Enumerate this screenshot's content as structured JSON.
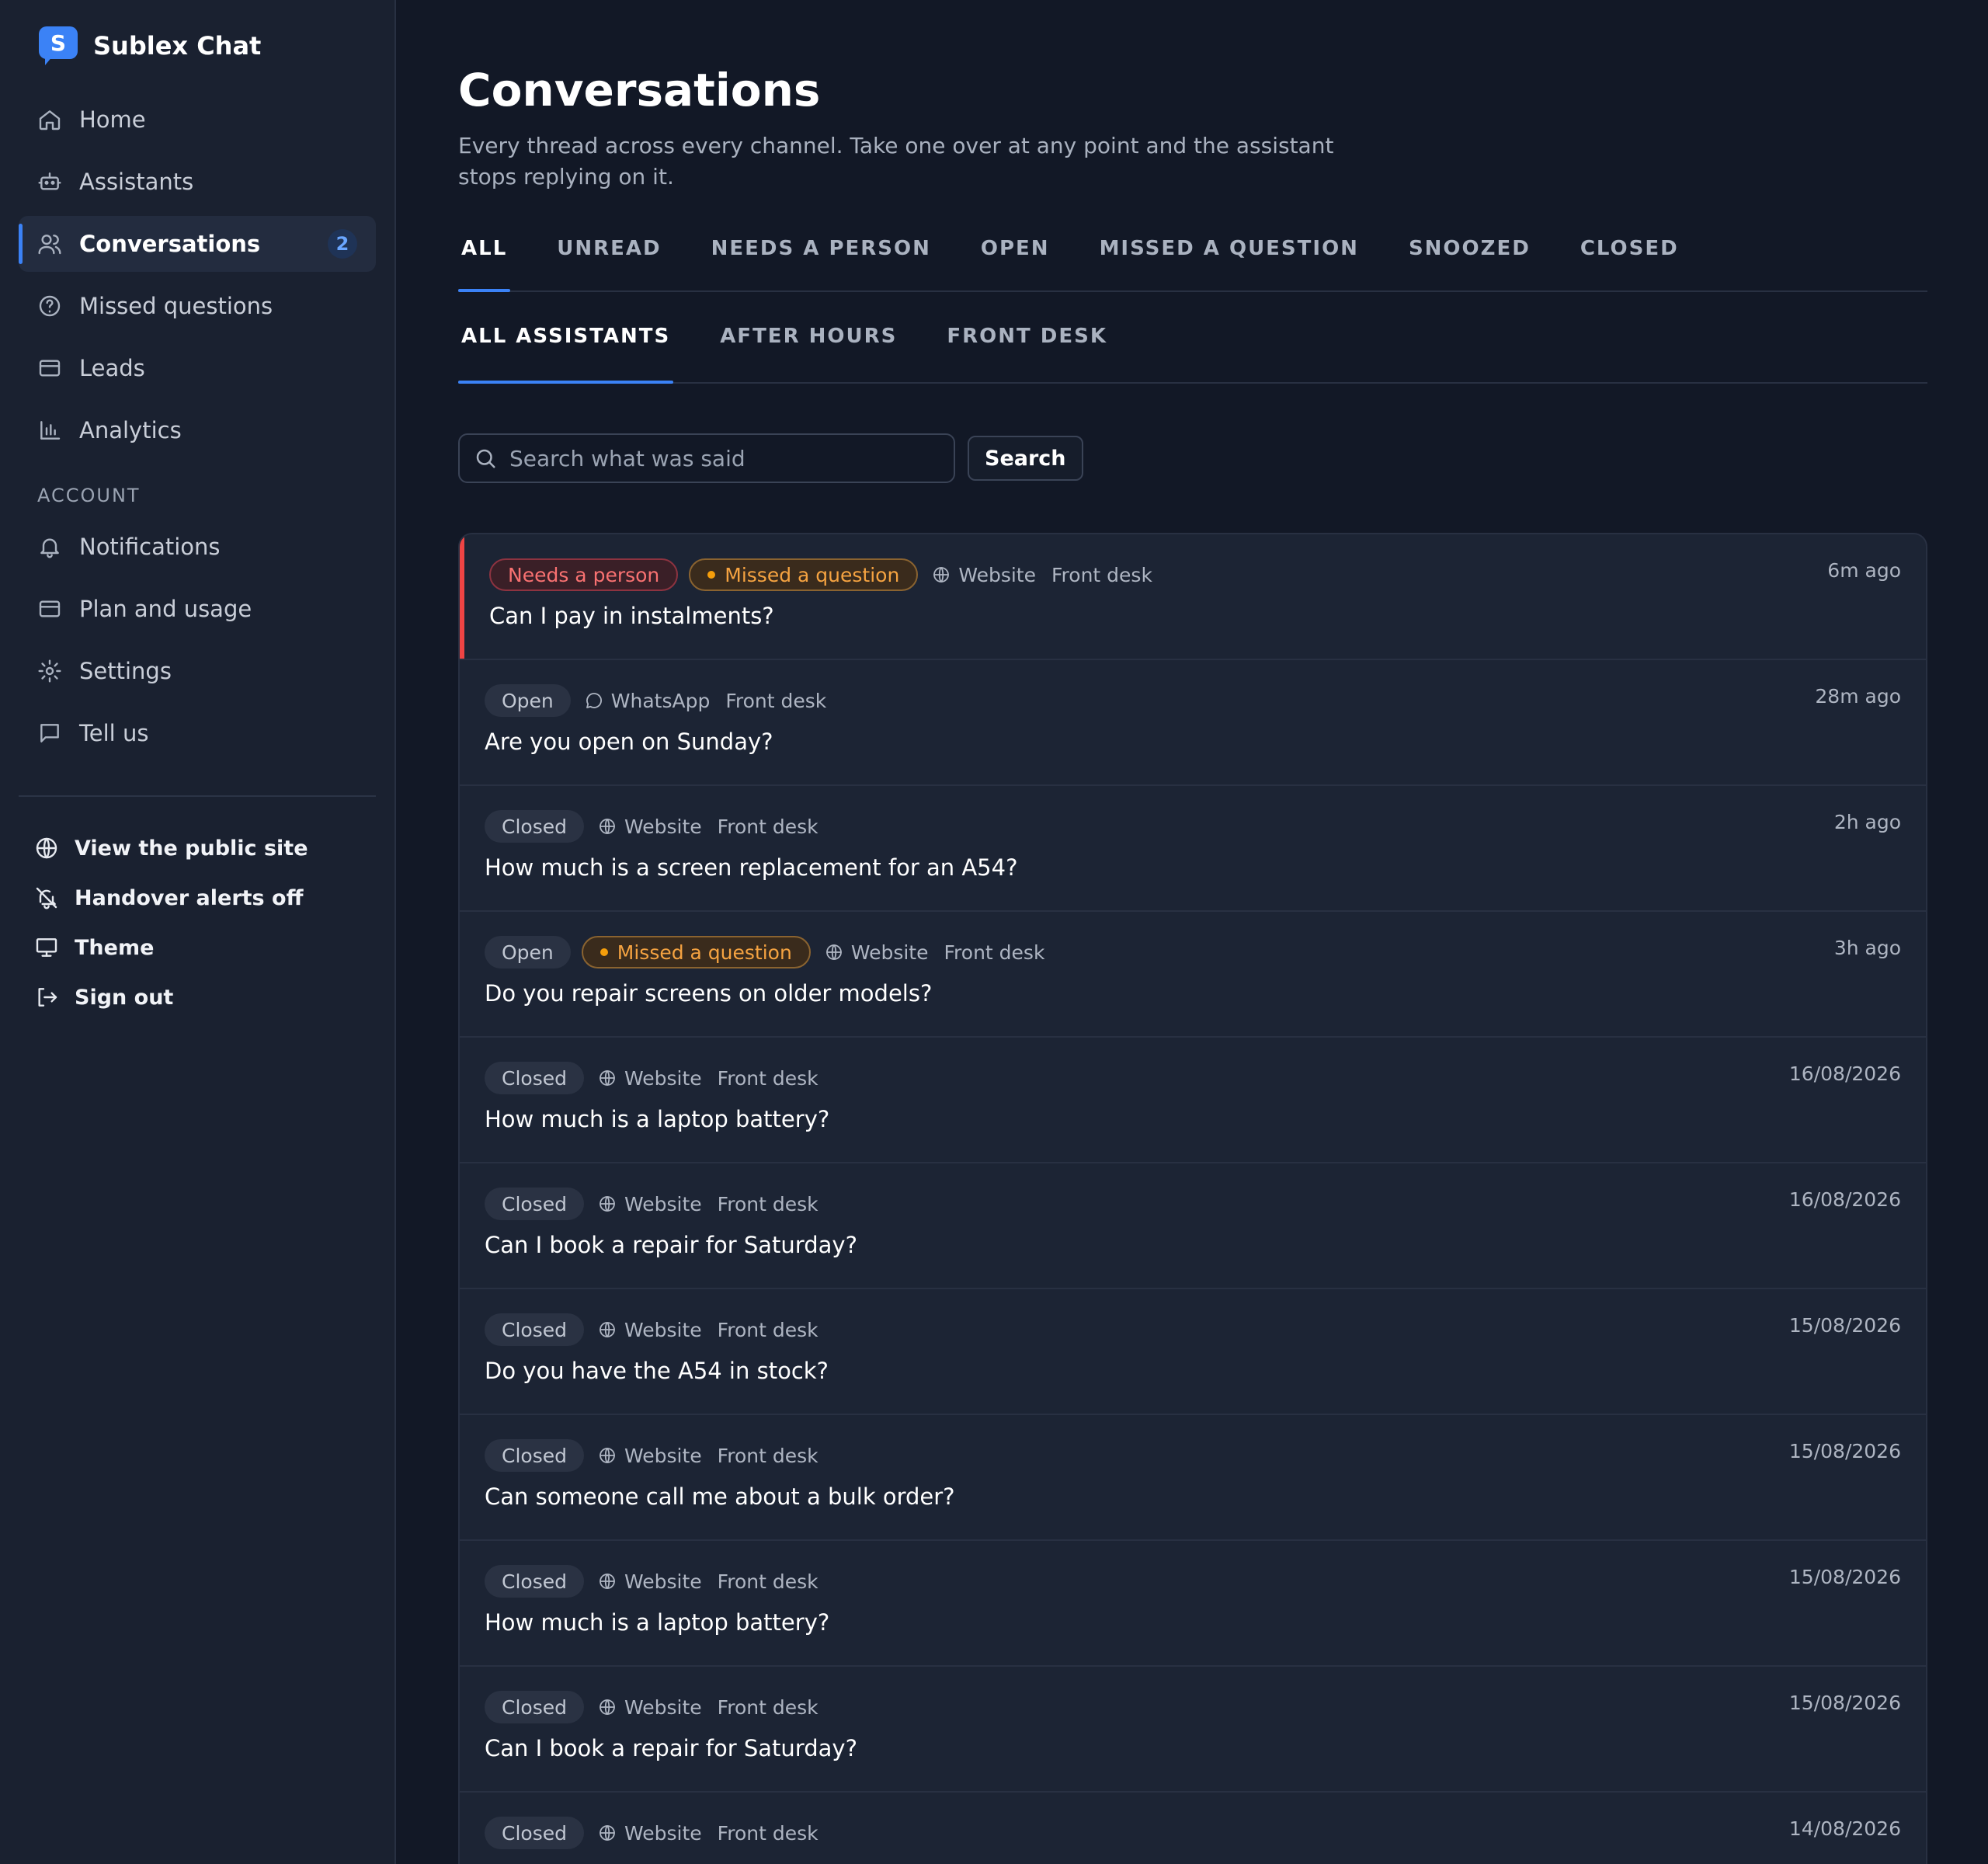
{
  "brand": {
    "logo_letter": "S",
    "name": "Sublex Chat",
    "accent": "#3b82f6"
  },
  "nav": {
    "items": [
      {
        "label": "Home",
        "icon": "home-icon"
      },
      {
        "label": "Assistants",
        "icon": "robot-icon"
      },
      {
        "label": "Conversations",
        "icon": "users-icon",
        "badge": "2",
        "active": true
      },
      {
        "label": "Missed questions",
        "icon": "help-circle-icon"
      },
      {
        "label": "Leads",
        "icon": "card-icon"
      },
      {
        "label": "Analytics",
        "icon": "bar-chart-icon"
      }
    ],
    "account_label": "ACCOUNT",
    "account_items": [
      {
        "label": "Notifications",
        "icon": "bell-icon"
      },
      {
        "label": "Plan and usage",
        "icon": "card-icon"
      },
      {
        "label": "Settings",
        "icon": "gear-icon"
      },
      {
        "label": "Tell us",
        "icon": "message-square-icon"
      }
    ],
    "footer_items": [
      {
        "label": "View the public site",
        "icon": "globe-icon"
      },
      {
        "label": "Handover alerts off",
        "icon": "bell-off-icon"
      },
      {
        "label": "Theme",
        "icon": "monitor-icon"
      },
      {
        "label": "Sign out",
        "icon": "sign-out-icon"
      }
    ]
  },
  "page": {
    "title": "Conversations",
    "subtitle": "Every thread across every channel. Take one over at any point and the assistant stops replying on it."
  },
  "tabs": [
    "ALL",
    "UNREAD",
    "NEEDS A PERSON",
    "OPEN",
    "MISSED A QUESTION",
    "SNOOZED",
    "CLOSED"
  ],
  "active_tab": "ALL",
  "subtabs": [
    "ALL ASSISTANTS",
    "AFTER HOURS",
    "FRONT DESK"
  ],
  "active_subtab": "ALL ASSISTANTS",
  "search": {
    "placeholder": "Search what was said",
    "value": "",
    "button_label": "Search"
  },
  "conversations": [
    {
      "tags": [
        {
          "text": "Needs a person",
          "kind": "danger"
        },
        {
          "text": "Missed a question",
          "kind": "warn"
        }
      ],
      "channel": "Website",
      "assistant": "Front desk",
      "time": "6m ago",
      "question": "Can I pay in instalments?",
      "flagged": true
    },
    {
      "tags": [
        {
          "text": "Open",
          "kind": "neutral"
        }
      ],
      "channel": "WhatsApp",
      "assistant": "Front desk",
      "time": "28m ago",
      "question": "Are you open on Sunday?"
    },
    {
      "tags": [
        {
          "text": "Closed",
          "kind": "neutral"
        }
      ],
      "channel": "Website",
      "assistant": "Front desk",
      "time": "2h ago",
      "question": "How much is a screen replacement for an A54?"
    },
    {
      "tags": [
        {
          "text": "Open",
          "kind": "neutral"
        },
        {
          "text": "Missed a question",
          "kind": "warn"
        }
      ],
      "channel": "Website",
      "assistant": "Front desk",
      "time": "3h ago",
      "question": "Do you repair screens on older models?"
    },
    {
      "tags": [
        {
          "text": "Closed",
          "kind": "neutral"
        }
      ],
      "channel": "Website",
      "assistant": "Front desk",
      "time": "16/08/2026",
      "question": "How much is a laptop battery?"
    },
    {
      "tags": [
        {
          "text": "Closed",
          "kind": "neutral"
        }
      ],
      "channel": "Website",
      "assistant": "Front desk",
      "time": "16/08/2026",
      "question": "Can I book a repair for Saturday?"
    },
    {
      "tags": [
        {
          "text": "Closed",
          "kind": "neutral"
        }
      ],
      "channel": "Website",
      "assistant": "Front desk",
      "time": "15/08/2026",
      "question": "Do you have the A54 in stock?"
    },
    {
      "tags": [
        {
          "text": "Closed",
          "kind": "neutral"
        }
      ],
      "channel": "Website",
      "assistant": "Front desk",
      "time": "15/08/2026",
      "question": "Can someone call me about a bulk order?"
    },
    {
      "tags": [
        {
          "text": "Closed",
          "kind": "neutral"
        }
      ],
      "channel": "Website",
      "assistant": "Front desk",
      "time": "15/08/2026",
      "question": "How much is a laptop battery?"
    },
    {
      "tags": [
        {
          "text": "Closed",
          "kind": "neutral"
        }
      ],
      "channel": "Website",
      "assistant": "Front desk",
      "time": "15/08/2026",
      "question": "Can I book a repair for Saturday?"
    },
    {
      "tags": [
        {
          "text": "Closed",
          "kind": "neutral"
        }
      ],
      "channel": "Website",
      "assistant": "Front desk",
      "time": "14/08/2026",
      "question": ""
    }
  ]
}
